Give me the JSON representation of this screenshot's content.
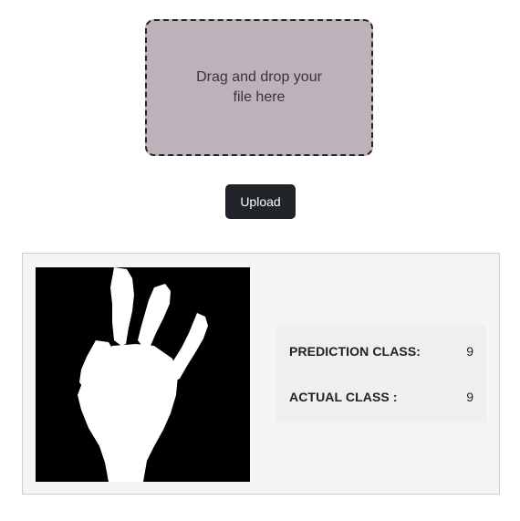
{
  "dropzone": {
    "text": "Drag and drop your file here"
  },
  "upload_button": {
    "label": "Upload"
  },
  "result": {
    "image_alt": "hand gesture image",
    "prediction_label": "PREDICTION CLASS:",
    "prediction_value": "9",
    "actual_label": "ACTUAL CLASS :",
    "actual_value": "9"
  },
  "colors": {
    "dropzone_bg": "#bdb2ba",
    "button_bg": "#212529",
    "card_bg": "#f5f5f5"
  }
}
